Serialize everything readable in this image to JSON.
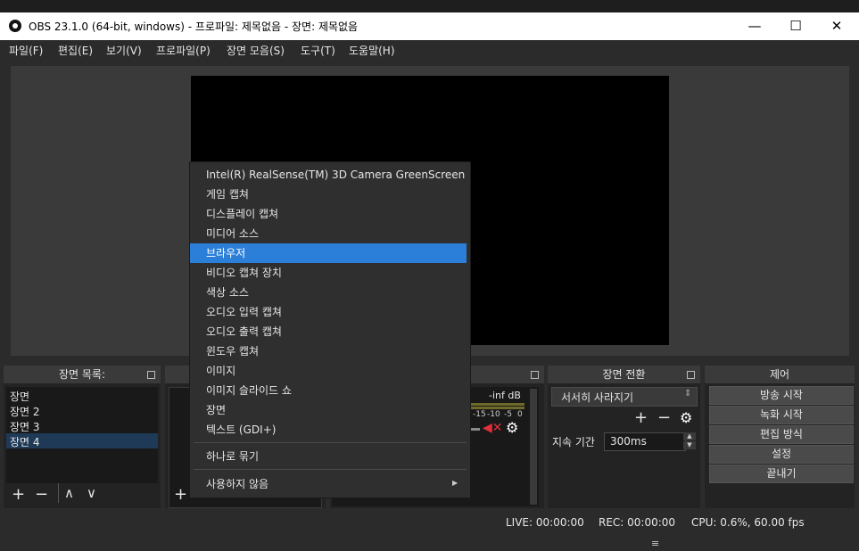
{
  "window": {
    "title": "OBS 23.1.0 (64-bit, windows) - 프로파일: 제목없음 - 장면: 제목없음",
    "minimize_icon": "—",
    "maximize_icon": "☐",
    "close_icon": "✕"
  },
  "menubar": {
    "items": [
      "파일(F)",
      "편집(E)",
      "보기(V)",
      "프로파일(P)",
      "장면 모음(S)",
      "도구(T)",
      "도움말(H)"
    ]
  },
  "scenes_dock": {
    "title": "장면 목록:",
    "items": [
      "장면",
      "장면 2",
      "장면 3",
      "장면 4"
    ],
    "selected_index": 3
  },
  "sources_dock": {
    "title": ""
  },
  "mixer": {
    "level": "-inf dB",
    "scale": [
      "-15",
      "-10",
      "-5",
      "0"
    ]
  },
  "transitions_dock": {
    "title": "장면 전환",
    "selected": "서서히 사라지기",
    "duration_label": "지속 기간",
    "duration_value": "300ms"
  },
  "controls_dock": {
    "title": "제어",
    "buttons": [
      "방송 시작",
      "녹화 시작",
      "편집 방식",
      "설정",
      "끝내기"
    ]
  },
  "context_menu": {
    "items": [
      "Intel(R) RealSense(TM) 3D Camera GreenScreen",
      "게임 캡쳐",
      "디스플레이 캡쳐",
      "미디어 소스",
      "브라우저",
      "비디오 캡쳐 장치",
      "색상 소스",
      "오디오 입력 캡쳐",
      "오디오 출력 캡쳐",
      "윈도우 캡쳐",
      "이미지",
      "이미지 슬라이드 쇼",
      "장면",
      "텍스트 (GDI+)"
    ],
    "highlighted_index": 4,
    "group_item": "하나로 묶기",
    "deprecated_item": "사용하지 않음"
  },
  "statusbar": {
    "live": "LIVE: 00:00:00",
    "rec": "REC: 00:00:00",
    "cpu": "CPU: 0.6%, 60.00 fps"
  },
  "colors": {
    "highlight": "#2b7fd8",
    "background": "#2b2b2b"
  }
}
